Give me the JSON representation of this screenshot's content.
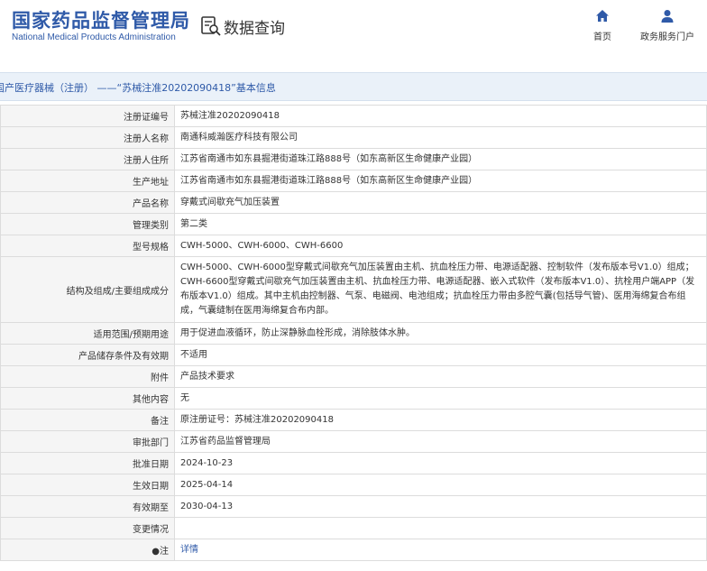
{
  "header": {
    "logo_cn": "国家药品监督管理局",
    "logo_en": "National Medical Products Administration",
    "query_title": "数据查询",
    "nav": [
      {
        "label": "首页",
        "icon": "home-icon"
      },
      {
        "label": "政务服务门户",
        "icon": "user-icon"
      }
    ]
  },
  "breadcrumb": "国产医疗器械（注册） ——“苏械注准20202090418”基本信息",
  "colors": {
    "brand": "#2f5aa8",
    "label_bg": "#f5f5f5",
    "crumb_bg": "#eaf1f9"
  },
  "rows": [
    {
      "label": "注册证编号",
      "value": "苏械注准20202090418"
    },
    {
      "label": "注册人名称",
      "value": "南通科威瀚医疗科技有限公司"
    },
    {
      "label": "注册人住所",
      "value": "江苏省南通市如东县掘港街道珠江路888号（如东高新区生命健康产业园）"
    },
    {
      "label": "生产地址",
      "value": "江苏省南通市如东县掘港街道珠江路888号（如东高新区生命健康产业园）"
    },
    {
      "label": "产品名称",
      "value": "穿戴式间歇充气加压装置"
    },
    {
      "label": "管理类别",
      "value": "第二类"
    },
    {
      "label": "型号规格",
      "value": "CWH-5000、CWH-6000、CWH-6600"
    },
    {
      "label": "结构及组成/主要组成成分",
      "value": "CWH-5000、CWH-6000型穿戴式间歇充气加压装置由主机、抗血栓压力带、电源适配器、控制软件（发布版本号V1.0）组成；CWH-6600型穿戴式间歇充气加压装置由主机、抗血栓压力带、电源适配器、嵌入式软件（发布版本V1.0）、抗栓用户端APP（发布版本V1.0）组成。其中主机由控制器、气泵、电磁阀、电池组成；抗血栓压力带由多腔气囊(包括导气管)、医用海绵复合布组成，气囊缝制在医用海绵复合布内部。"
    },
    {
      "label": "适用范围/预期用途",
      "value": "用于促进血液循环，防止深静脉血栓形成，消除肢体水肿。"
    },
    {
      "label": "产品储存条件及有效期",
      "value": "不适用"
    },
    {
      "label": "附件",
      "value": "产品技术要求"
    },
    {
      "label": "其他内容",
      "value": "无"
    },
    {
      "label": "备注",
      "value": "原注册证号：苏械注准20202090418"
    },
    {
      "label": "审批部门",
      "value": "江苏省药品监督管理局"
    },
    {
      "label": "批准日期",
      "value": "2024-10-23"
    },
    {
      "label": "生效日期",
      "value": "2025-04-14"
    },
    {
      "label": "有效期至",
      "value": "2030-04-13"
    },
    {
      "label": "变更情况",
      "value": ""
    },
    {
      "label": "●注",
      "value": "详情"
    }
  ]
}
